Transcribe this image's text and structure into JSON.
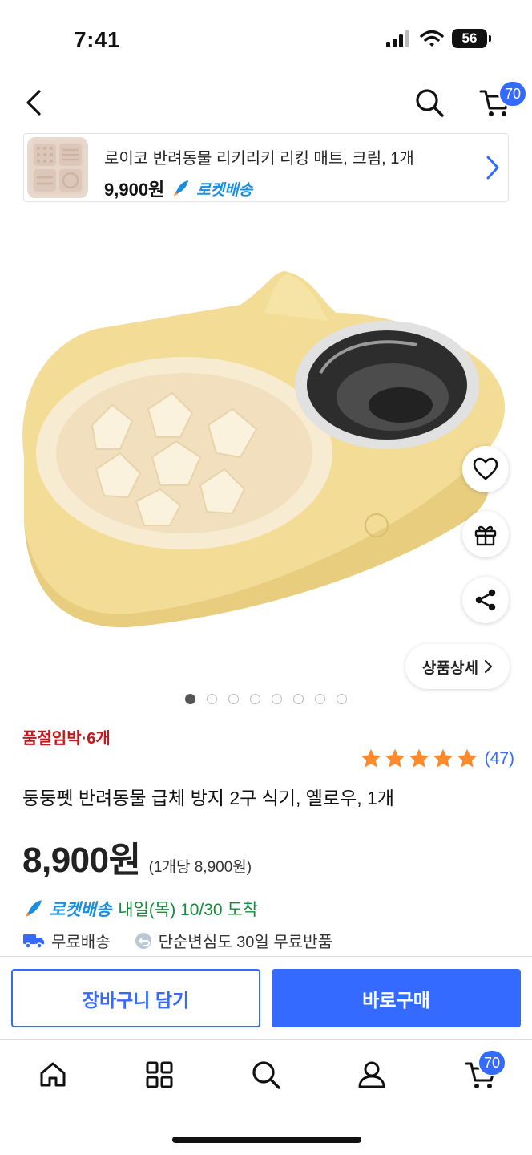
{
  "status_bar": {
    "time": "7:41",
    "battery": "56"
  },
  "header": {
    "cart_count": "70"
  },
  "recommendation": {
    "title": "로이코 반려동물 리키리키 리킹 매트, 크림, 1개",
    "price": "9,900원",
    "rocket_label": "로켓배송"
  },
  "product": {
    "detail_button": "상품상세",
    "carousel": {
      "total": 8,
      "active_index": 0
    },
    "stock_notice": "품절임박·6개",
    "rating": {
      "stars": 5,
      "count": "(47)"
    },
    "title": "둥둥펫 반려동물 급체 방지 2구 식기, 옐로우, 1개",
    "price": "8,900원",
    "unit_price": "(1개당 8,900원)",
    "delivery": {
      "rocket_label": "로켓배송",
      "date": "내일(목) 10/30 도착"
    },
    "perks": {
      "shipping": "무료배송",
      "returns": "단순변심도 30일 무료반품"
    }
  },
  "actions": {
    "add_to_cart": "장바구니 담기",
    "buy_now": "바로구매"
  },
  "bottom_nav": {
    "cart_count": "70"
  },
  "colors": {
    "accent": "#346aff",
    "stock_red": "#c8161d",
    "rocket_blue": "#1b8ee0",
    "delivery_green": "#138c3c",
    "star": "#ff8a2b"
  }
}
